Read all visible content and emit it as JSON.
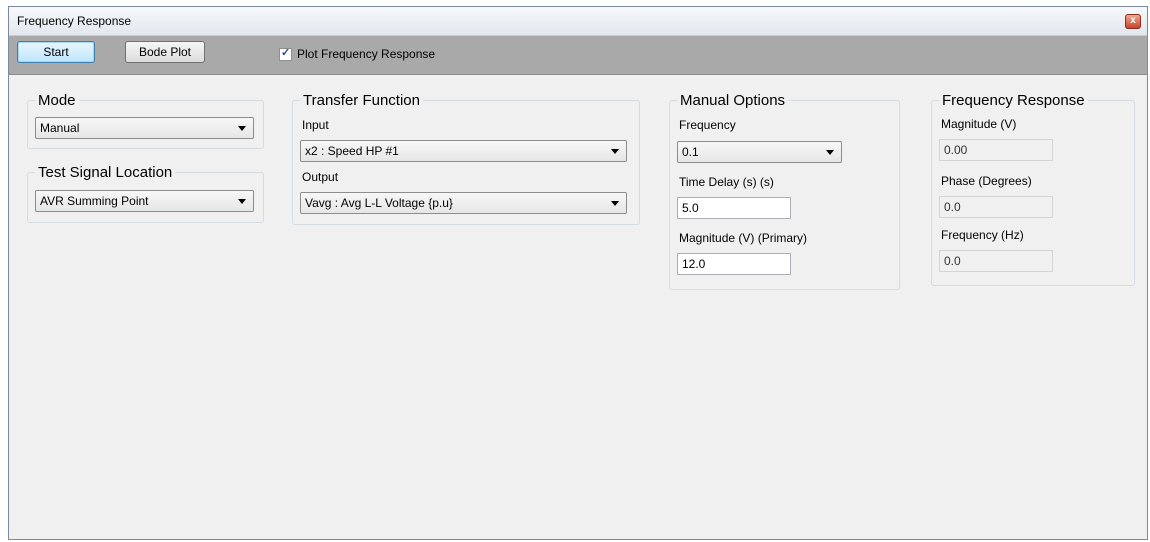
{
  "window": {
    "title": "Frequency Response",
    "close_label": "x"
  },
  "toolbar": {
    "start_label": "Start",
    "bode_label": "Bode Plot",
    "plot_checkbox_label": "Plot Frequency Response",
    "plot_checked": true
  },
  "mode": {
    "legend": "Mode",
    "value": "Manual"
  },
  "test_signal": {
    "legend": "Test Signal Location",
    "value": "AVR Summing Point"
  },
  "transfer_function": {
    "legend": "Transfer Function",
    "input_label": "Input",
    "input_value": "x2 : Speed HP #1",
    "output_label": "Output",
    "output_value": "Vavg : Avg L-L Voltage {p.u}"
  },
  "manual_options": {
    "legend": "Manual Options",
    "frequency_label": "Frequency",
    "frequency_value": "0.1",
    "time_delay_label": "Time Delay (s) (s)",
    "time_delay_value": "5.0",
    "magnitude_label": "Magnitude (V) (Primary)",
    "magnitude_value": "12.0"
  },
  "frequency_response": {
    "legend": "Frequency Response",
    "magnitude_label": "Magnitude (V)",
    "magnitude_value": "0.00",
    "phase_label": "Phase (Degrees)",
    "phase_value": "0.0",
    "frequency_label": "Frequency (Hz)",
    "frequency_value": "0.0"
  }
}
